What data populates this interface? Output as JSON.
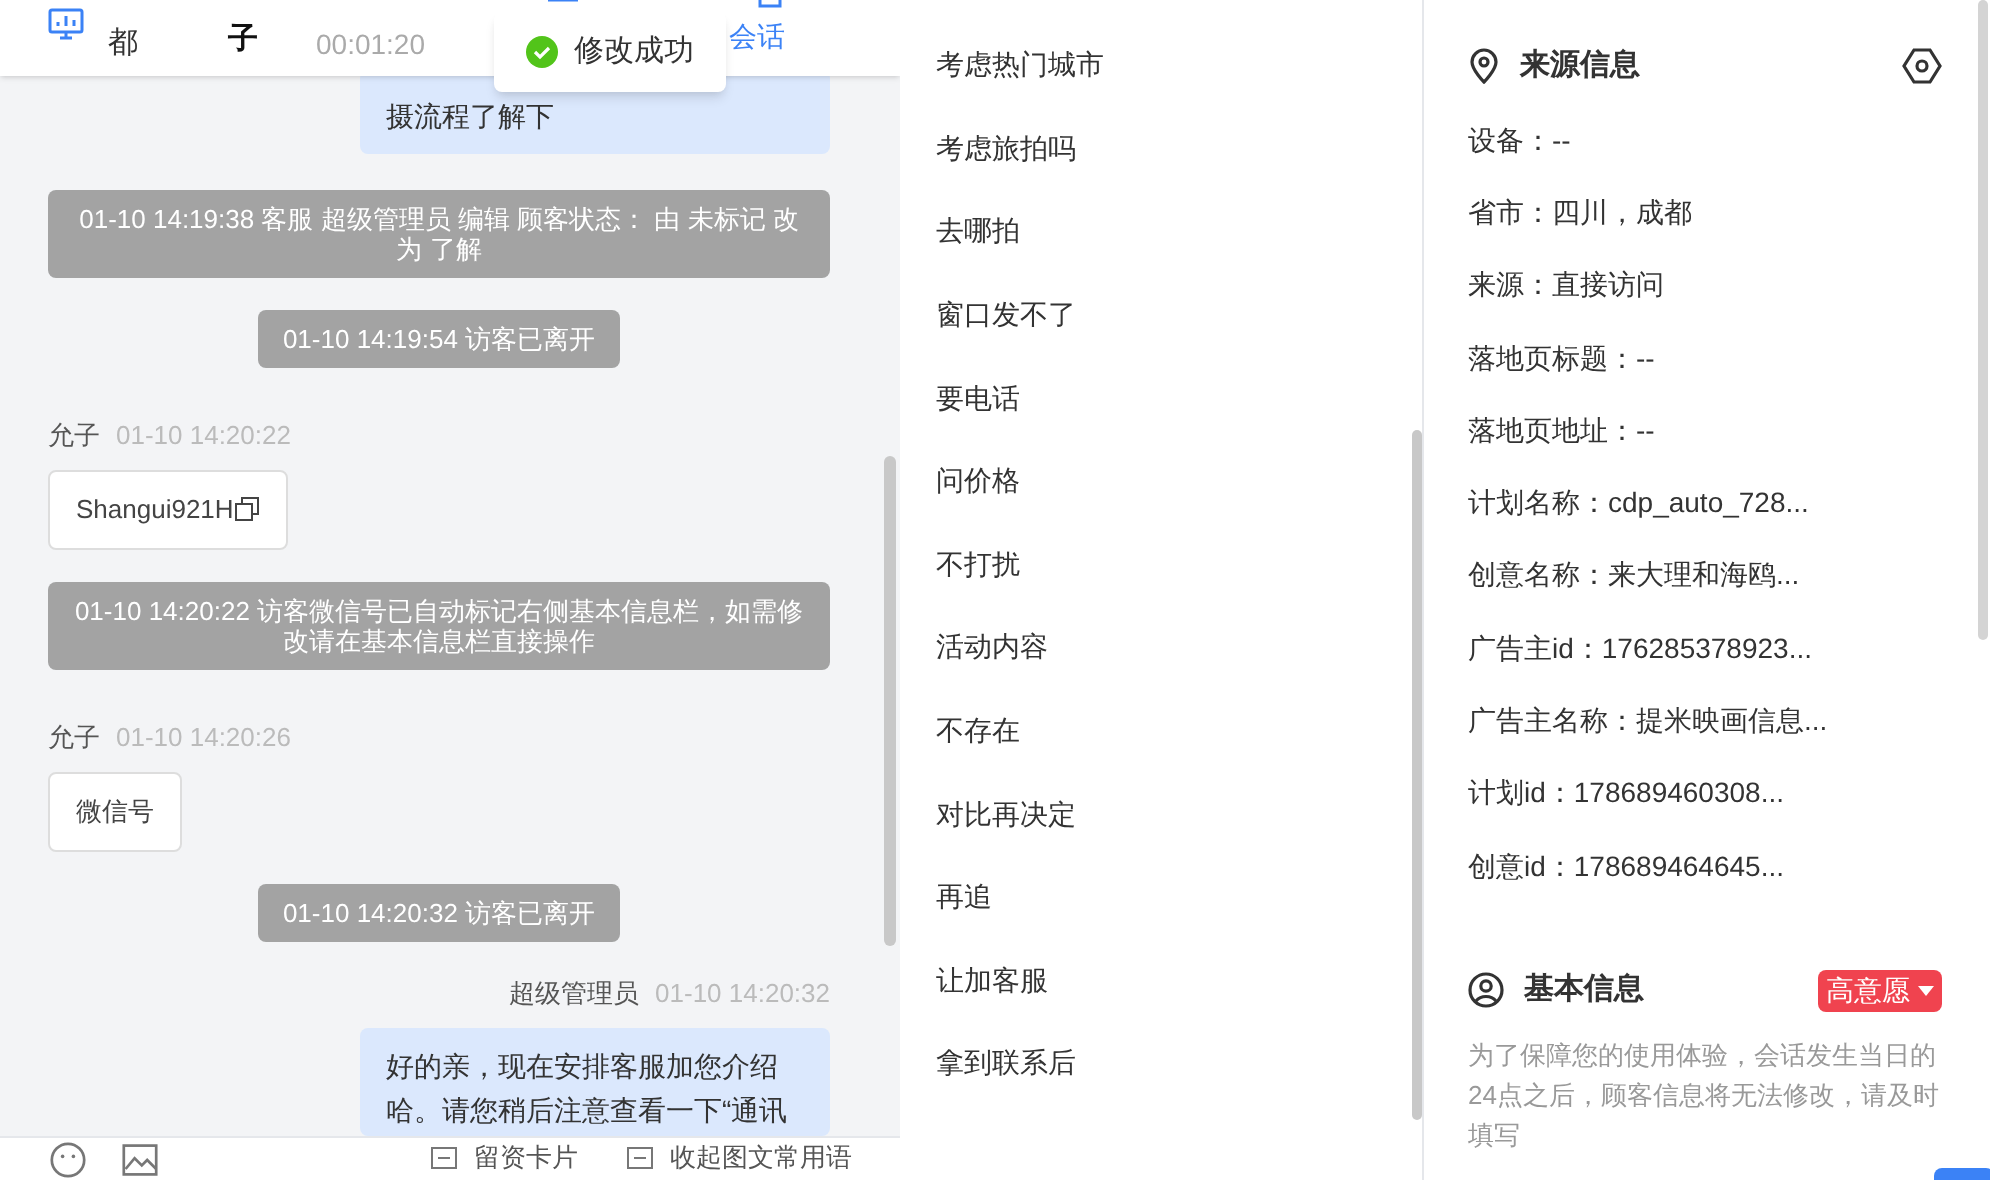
{
  "header": {
    "location": "都",
    "visitor": "子",
    "duration": "00:01:20",
    "end_label": "会话"
  },
  "toast": {
    "text": "修改成功"
  },
  "messages": [
    {
      "kind": "agent",
      "text": "摄流程了解下"
    },
    {
      "kind": "system",
      "text": "01-10 14:19:38 客服 超级管理员 编辑 顾客状态： 由 未标记 改为 了解"
    },
    {
      "kind": "system",
      "text": "01-10 14:19:54 访客已离开"
    },
    {
      "kind": "visitor",
      "sender": "允子",
      "time": "01-10 14:20:22",
      "text": "Shangui921H"
    },
    {
      "kind": "system",
      "text": "01-10 14:20:22 访客微信号已自动标记右侧基本信息栏，如需修改请在基本信息栏直接操作"
    },
    {
      "kind": "visitor",
      "sender": "允子",
      "time": "01-10 14:20:26",
      "text": "微信号"
    },
    {
      "kind": "system",
      "text": "01-10 14:20:32 访客已离开"
    },
    {
      "kind": "agent",
      "sender": "超级管理员",
      "time": "01-10 14:20:32",
      "text": "好的亲，现在安排客服加您介绍哈。请您稍后注意查看一下“通讯"
    }
  ],
  "toolbar": {
    "actions": [
      "留资卡片",
      "收起图文常用语"
    ]
  },
  "phrases": [
    "考虑热门城市",
    "考虑旅拍吗",
    "去哪拍",
    "窗口发不了",
    "要电话",
    "问价格",
    "不打扰",
    "活动内容",
    "不存在",
    "对比再决定",
    "再追",
    "让加客服",
    "拿到联系后"
  ],
  "source_info": {
    "title": "来源信息",
    "fields": [
      "设备：--",
      "省市：四川，成都",
      "来源：直接访问",
      "落地页标题：--",
      "落地页地址：--",
      "计划名称：cdp_auto_728...",
      "创意名称：来大理和海鸥...",
      "广告主id：176285378923...",
      "广告主名称：提米映画信息...",
      "计划id：178689460308...",
      "创意id：178689464645..."
    ]
  },
  "basic_info": {
    "title": "基本信息",
    "intent": "高意愿",
    "note": "为了保障您的使用体验，会话发生当日的24点之后，顾客信息将无法修改，请及时填写"
  }
}
